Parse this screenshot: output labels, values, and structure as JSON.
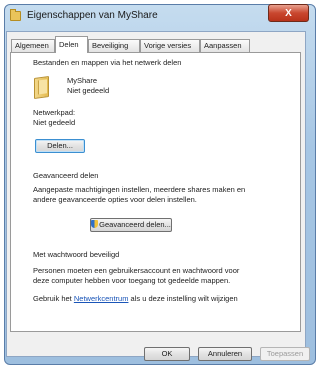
{
  "window": {
    "title": "Eigenschappen van MyShare",
    "close_label": "X"
  },
  "tabs": [
    {
      "label": "Algemeen"
    },
    {
      "label": "Delen",
      "active": true
    },
    {
      "label": "Beveiliging"
    },
    {
      "label": "Vorige versies"
    },
    {
      "label": "Aanpassen"
    }
  ],
  "network_sharing": {
    "heading": "Bestanden en mappen via het netwerk delen",
    "folder_name": "MyShare",
    "folder_status": "Niet gedeeld",
    "path_label": "Netwerkpad:",
    "path_value": "Niet gedeeld",
    "share_button": "Delen..."
  },
  "advanced": {
    "heading": "Geavanceerd delen",
    "description_line1": "Aangepaste machtigingen instellen, meerdere shares maken en",
    "description_line2": "andere geavanceerde opties voor delen instellen.",
    "button": "Geavanceerd delen..."
  },
  "password": {
    "heading": "Met wachtwoord beveiligd",
    "description_line1": "Personen moeten een gebruikersaccount en wachtwoord voor",
    "description_line2": "deze computer hebben voor toegang tot gedeelde mappen.",
    "link_prefix": "Gebruik het ",
    "link_text": "Netwerkcentrum",
    "link_suffix": " als u deze instelling wilt wijzigen"
  },
  "footer": {
    "ok": "OK",
    "cancel": "Annuleren",
    "apply": "Toepassen"
  }
}
